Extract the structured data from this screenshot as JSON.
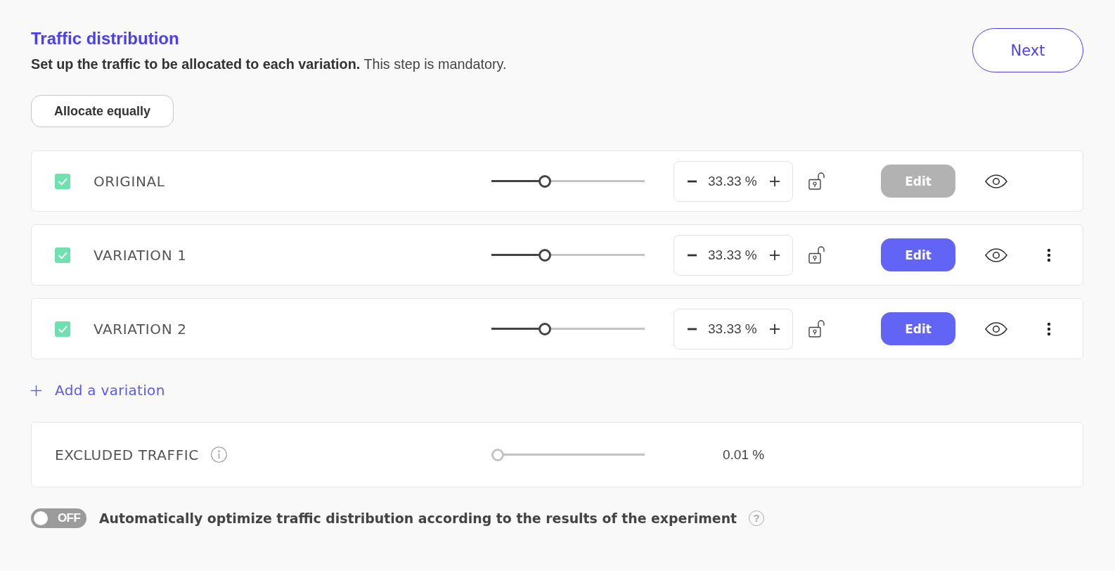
{
  "header": {
    "title": "Traffic distribution",
    "subtitle": "**Set up the traffic to be allocated to each variation.** This step is mandatory.",
    "next_button": "Next"
  },
  "allocate_button": "Allocate equally",
  "variations": [
    {
      "name": "ORIGINAL",
      "checked": true,
      "level": 0.3333,
      "value": "33.33 %",
      "locked": false,
      "edit": {
        "label": "Edit",
        "disabled": true
      },
      "has_menu": false
    },
    {
      "name": "VARIATION 1",
      "checked": true,
      "level": 0.3333,
      "value": "33.33 %",
      "locked": false,
      "edit": {
        "label": "Edit",
        "disabled": false
      },
      "has_menu": true
    },
    {
      "name": "VARIATION 2",
      "checked": true,
      "level": 0.3333,
      "value": "33.33 %",
      "locked": false,
      "edit": {
        "label": "Edit",
        "disabled": false
      },
      "has_menu": true
    }
  ],
  "add_variation": "Add a variation",
  "excluded_traffic": {
    "label": "EXCLUDED TRAFFIC",
    "level": 0.0001,
    "disabled": true,
    "value": "0.01 %"
  },
  "auto_optimize": {
    "on": false,
    "switch_text": "OFF",
    "label": "Automatically optimize traffic distribution according to the results of the experiment",
    "help_icon": "?"
  }
}
